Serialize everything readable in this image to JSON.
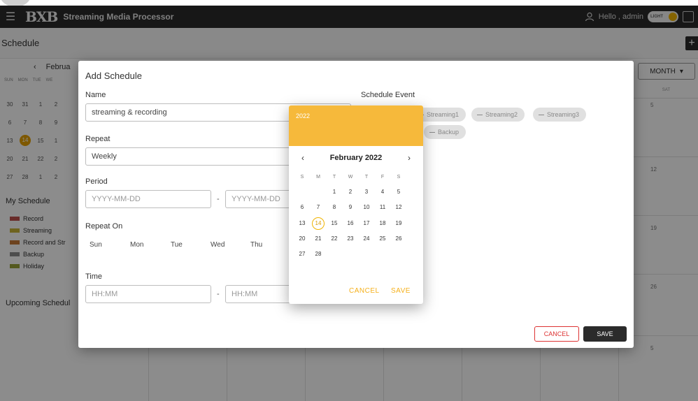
{
  "app": {
    "logo": "BXB",
    "title": "Streaming Media Processor",
    "greeting": "Hello , admin",
    "theme_toggle": "LIGHT"
  },
  "page": {
    "title": "Schedule",
    "add_icon": "+"
  },
  "mini_calendar": {
    "month": "Februa",
    "prev_icon": "‹",
    "dow": [
      "SUN",
      "MON",
      "TUE",
      "WE"
    ],
    "rows": [
      [
        "30",
        "31",
        "1",
        "2"
      ],
      [
        "6",
        "7",
        "8",
        "9"
      ],
      [
        "13",
        "14",
        "15",
        "1"
      ],
      [
        "20",
        "21",
        "22",
        "2"
      ],
      [
        "27",
        "28",
        "1",
        "2"
      ]
    ]
  },
  "my_schedule": {
    "title": "My Schedule",
    "items": [
      {
        "label": "Record",
        "color": "#c0504d"
      },
      {
        "label": "Streaming",
        "color": "#c9b43a"
      },
      {
        "label": "Record and Str",
        "color": "#c77a3a"
      },
      {
        "label": "Backup",
        "color": "#8c8c8c"
      },
      {
        "label": "Holiday",
        "color": "#9aa33a"
      }
    ]
  },
  "upcoming": {
    "title": "Upcoming Schedul"
  },
  "calendar": {
    "view": "MONTH",
    "sat_label": "SAT",
    "sat_dates": [
      "5",
      "12",
      "19",
      "26",
      "5"
    ]
  },
  "dialog": {
    "title": "Add Schedule",
    "name_label": "Name",
    "name_value": "streaming & recording",
    "repeat_label": "Repeat",
    "repeat_value": "Weekly",
    "period_label": "Period",
    "period_start_placeholder": "YYYY-MM-DD",
    "period_end_placeholder": "YYYY-MM-DD",
    "repeat_on_label": "Repeat On",
    "days": [
      "Sun",
      "Mon",
      "Tue",
      "Wed",
      "Thu"
    ],
    "time_label": "Time",
    "time_start_placeholder": "HH:MM",
    "time_end_placeholder": "HH:MM",
    "schedule_event_label": "Schedule Event",
    "events": [
      "Streaming1",
      "Streaming2",
      "Streaming3",
      "Backup"
    ],
    "cancel": "CANCEL",
    "save": "SAVE"
  },
  "datepicker": {
    "year": "2022",
    "month": "February 2022",
    "prev": "‹",
    "next": "›",
    "dow": [
      "S",
      "M",
      "T",
      "W",
      "T",
      "F",
      "S"
    ],
    "weeks": [
      [
        "",
        "",
        "1",
        "2",
        "3",
        "4",
        "5"
      ],
      [
        "6",
        "7",
        "8",
        "9",
        "10",
        "11",
        "12"
      ],
      [
        "13",
        "14",
        "15",
        "16",
        "17",
        "18",
        "19"
      ],
      [
        "20",
        "21",
        "22",
        "23",
        "24",
        "25",
        "26"
      ],
      [
        "27",
        "28",
        "",
        "",
        "",
        "",
        ""
      ]
    ],
    "selected": "14",
    "cancel": "CANCEL",
    "save": "SAVE"
  }
}
